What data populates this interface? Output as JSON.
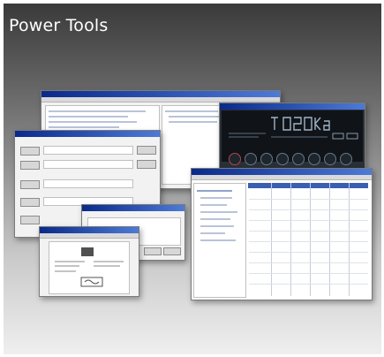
{
  "title": "Power Tools"
}
